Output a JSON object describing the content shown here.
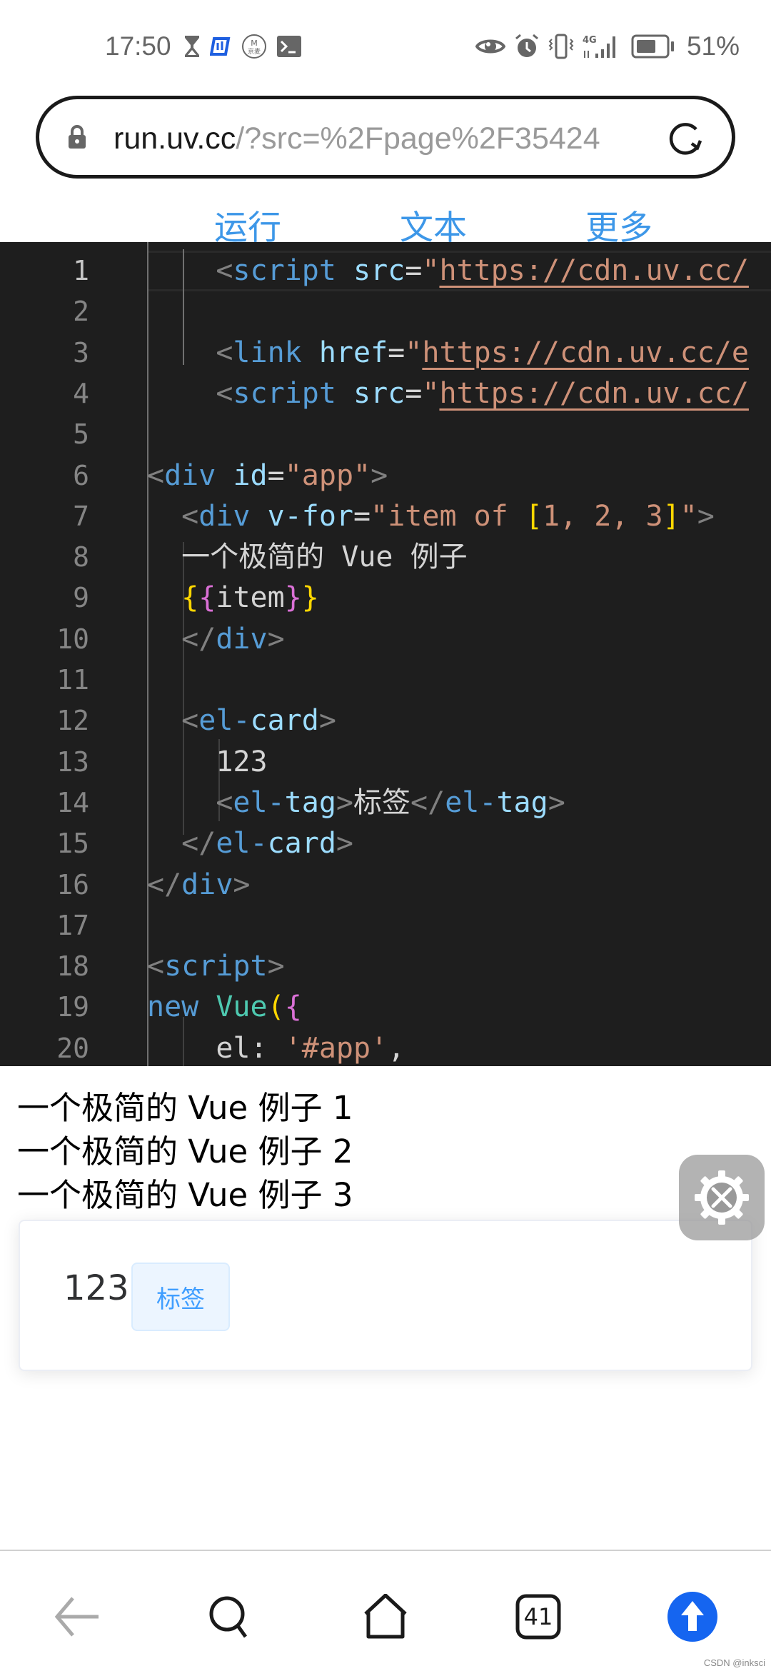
{
  "status_bar": {
    "time": "17:50",
    "left_icons": [
      "hourglass-icon",
      "app-notification-icon",
      "m-badge-icon",
      "terminal-icon"
    ],
    "right_icons": [
      "eye-icon",
      "alarm-icon",
      "vibrate-icon",
      "4g-signal-icon",
      "battery-icon"
    ],
    "network": "4G",
    "battery_percent": "51%",
    "battery_level": 0.51
  },
  "browser": {
    "url_host": "run.uv.cc",
    "url_rest": "/?src=%2Fpage%2F35424"
  },
  "actions": {
    "run": "运行",
    "text": "文本",
    "more": "更多"
  },
  "editor": {
    "lines": [
      {
        "n": "1",
        "tokens": [
          [
            "punc",
            "    <"
          ],
          [
            "tag",
            "script"
          ],
          [
            "text",
            " "
          ],
          [
            "attr",
            "src"
          ],
          [
            "text",
            "="
          ],
          [
            "str",
            "\""
          ],
          [
            "url",
            "https://cdn.uv.cc/"
          ]
        ]
      },
      {
        "n": "2",
        "tokens": []
      },
      {
        "n": "3",
        "tokens": [
          [
            "punc",
            "    <"
          ],
          [
            "tag",
            "link"
          ],
          [
            "text",
            " "
          ],
          [
            "attr",
            "href"
          ],
          [
            "text",
            "="
          ],
          [
            "str",
            "\""
          ],
          [
            "url",
            "https://cdn.uv.cc/e"
          ]
        ]
      },
      {
        "n": "4",
        "tokens": [
          [
            "punc",
            "    <"
          ],
          [
            "tag",
            "script"
          ],
          [
            "text",
            " "
          ],
          [
            "attr",
            "src"
          ],
          [
            "text",
            "="
          ],
          [
            "str",
            "\""
          ],
          [
            "url",
            "https://cdn.uv.cc/"
          ]
        ]
      },
      {
        "n": "5",
        "tokens": []
      },
      {
        "n": "6",
        "tokens": [
          [
            "punc",
            "<"
          ],
          [
            "tag",
            "div"
          ],
          [
            "text",
            " "
          ],
          [
            "attr",
            "id"
          ],
          [
            "text",
            "="
          ],
          [
            "str",
            "\"app\""
          ],
          [
            "punc",
            ">"
          ]
        ]
      },
      {
        "n": "7",
        "tokens": [
          [
            "punc",
            "  <"
          ],
          [
            "tag",
            "div"
          ],
          [
            "text",
            " "
          ],
          [
            "attr",
            "v-for"
          ],
          [
            "text",
            "="
          ],
          [
            "str",
            "\"item of "
          ],
          [
            "brace1",
            "["
          ],
          [
            "str",
            "1, 2, 3"
          ],
          [
            "brace1",
            "]"
          ],
          [
            "str",
            "\""
          ],
          [
            "punc",
            ">"
          ]
        ]
      },
      {
        "n": "8",
        "tokens": [
          [
            "text",
            "  一个极简的 Vue 例子"
          ]
        ]
      },
      {
        "n": "9",
        "tokens": [
          [
            "text",
            "  "
          ],
          [
            "brace1",
            "{"
          ],
          [
            "brace2",
            "{"
          ],
          [
            "text",
            "item"
          ],
          [
            "brace2",
            "}"
          ],
          [
            "brace1",
            "}"
          ]
        ]
      },
      {
        "n": "10",
        "tokens": [
          [
            "punc",
            "  </"
          ],
          [
            "tag",
            "div"
          ],
          [
            "punc",
            ">"
          ]
        ]
      },
      {
        "n": "11",
        "tokens": []
      },
      {
        "n": "12",
        "tokens": [
          [
            "punc",
            "  <"
          ],
          [
            "tag",
            "el-"
          ],
          [
            "ctag",
            "card"
          ],
          [
            "punc",
            ">"
          ]
        ]
      },
      {
        "n": "13",
        "tokens": [
          [
            "text",
            "    123"
          ]
        ]
      },
      {
        "n": "14",
        "tokens": [
          [
            "punc",
            "    <"
          ],
          [
            "tag",
            "el-"
          ],
          [
            "ctag",
            "tag"
          ],
          [
            "punc",
            ">"
          ],
          [
            "text",
            "标签"
          ],
          [
            "punc",
            "</"
          ],
          [
            "tag",
            "el-"
          ],
          [
            "ctag",
            "tag"
          ],
          [
            "punc",
            ">"
          ]
        ]
      },
      {
        "n": "15",
        "tokens": [
          [
            "punc",
            "  </"
          ],
          [
            "tag",
            "el-"
          ],
          [
            "ctag",
            "card"
          ],
          [
            "punc",
            ">"
          ]
        ]
      },
      {
        "n": "16",
        "tokens": [
          [
            "punc",
            "</"
          ],
          [
            "tag",
            "div"
          ],
          [
            "punc",
            ">"
          ]
        ]
      },
      {
        "n": "17",
        "tokens": []
      },
      {
        "n": "18",
        "tokens": [
          [
            "punc",
            "<"
          ],
          [
            "tag",
            "script"
          ],
          [
            "punc",
            ">"
          ]
        ]
      },
      {
        "n": "19",
        "tokens": [
          [
            "kw",
            "new"
          ],
          [
            "text",
            " "
          ],
          [
            "cls",
            "Vue"
          ],
          [
            "brace1",
            "("
          ],
          [
            "brace2",
            "{"
          ]
        ]
      },
      {
        "n": "20",
        "tokens": [
          [
            "text",
            "    el: "
          ],
          [
            "str",
            "'#app'"
          ],
          [
            "text",
            ","
          ]
        ]
      }
    ]
  },
  "output": {
    "lines": [
      "一个极简的 Vue 例子 1",
      "一个极简的 Vue 例子 2",
      "一个极简的 Vue 例子 3"
    ],
    "card": {
      "text": "123",
      "tag": "标签"
    },
    "tool_button_icon": "gear-wrench-icon"
  },
  "bottom_nav": {
    "back": "back-icon",
    "search": "search-icon",
    "home": "home-icon",
    "tabs_count": "41",
    "upload": "upload-arrow-icon"
  },
  "watermark": "CSDN @inksci"
}
